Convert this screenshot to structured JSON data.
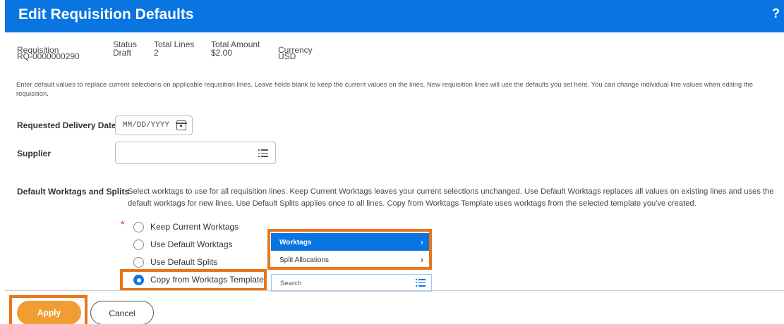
{
  "header": {
    "title": "Edit Requisition Defaults",
    "help": "?",
    "color": "#0875e1"
  },
  "summary": {
    "requisition_label": "Requisition",
    "requisition_value": "RQ-0000000290",
    "status_label": "Status",
    "status_value": "Draft",
    "total_lines_label": "Total Lines",
    "total_lines_value": "2",
    "total_amount_label": "Total Amount",
    "total_amount_value": "$2.00",
    "currency_label": "Currency",
    "currency_value": "USD"
  },
  "instructions": "Enter default values to replace current selections on applicable requisition lines. Leave fields blank to keep the current values on the lines. New requisition lines will use the defaults you set here. You can change individual line values when editing the requisition.",
  "form": {
    "delivery_date_label": "Requested Delivery Date",
    "delivery_date_placeholder": "MM/DD/YYYY",
    "supplier_label": "Supplier",
    "supplier_value": "",
    "worktags_label": "Default Worktags and Splits",
    "worktags_description": "Select worktags to use for all requisition lines. Keep Current Worktags leaves your current selections unchanged. Use Default Worktags replaces all values on existing lines and uses the default worktags for new lines. Use Default Splits applies once to all lines. Copy from Worktags Template uses worktags from the selected template you've created.",
    "required_mark": "*",
    "options": [
      {
        "label": "Keep Current Worktags",
        "selected": false
      },
      {
        "label": "Use Default Worktags",
        "selected": false
      },
      {
        "label": "Use Default Splits",
        "selected": false
      },
      {
        "label": "Copy from Worktags Template",
        "selected": true
      }
    ]
  },
  "dropdown": {
    "items": [
      {
        "label": "Worktags",
        "active": true
      },
      {
        "label": "Split Allocations",
        "active": false
      }
    ],
    "chevron": "›",
    "search_placeholder": "Search"
  },
  "footer": {
    "apply_label": "Apply",
    "cancel_label": "Cancel",
    "apply_color": "#f29d33"
  },
  "highlight_color": "#e8761a"
}
